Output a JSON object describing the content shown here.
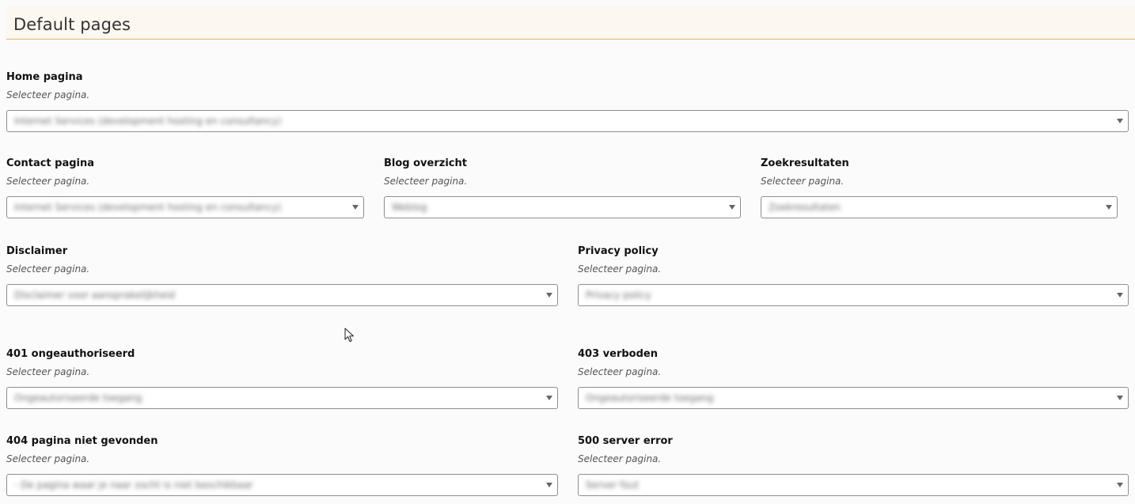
{
  "section": {
    "title": "Default pages"
  },
  "fields": {
    "home": {
      "label": "Home pagina",
      "hint": "Selecteer pagina.",
      "value": "Internet Services (development hosting en consultancy)"
    },
    "contact": {
      "label": "Contact pagina",
      "hint": "Selecteer pagina.",
      "value": "Internet Services (development hosting en consultancy)"
    },
    "blog": {
      "label": "Blog overzicht",
      "hint": "Selecteer pagina.",
      "value": "Weblog"
    },
    "search": {
      "label": "Zoekresultaten",
      "hint": "Selecteer pagina.",
      "value": "Zoekresultaten"
    },
    "disclaimer": {
      "label": "Disclaimer",
      "hint": "Selecteer pagina.",
      "value": "Disclaimer voor aansprakelijkheid"
    },
    "privacy": {
      "label": "Privacy policy",
      "hint": "Selecteer pagina.",
      "value": "Privacy policy"
    },
    "e401": {
      "label": "401 ongeauthoriseerd",
      "hint": "Selecteer pagina.",
      "value": "Ongeautoriseerde toegang"
    },
    "e403": {
      "label": "403 verboden",
      "hint": "Selecteer pagina.",
      "value": "Ongeautoriseerde toegang"
    },
    "e404": {
      "label": "404 pagina niet gevonden",
      "hint": "Selecteer pagina.",
      "value": "- De pagina waar je naar zocht is niet beschikbaar"
    },
    "e500": {
      "label": "500 server error",
      "hint": "Selecteer pagina.",
      "value": "Server fout"
    }
  },
  "icons": {
    "dropdown": "chevron-down-icon",
    "cursor": "mouse-pointer-icon"
  },
  "colors": {
    "header_bg": "#fdf8ef",
    "header_border": "#e4b45c",
    "page_bg": "#fbfbfb",
    "select_border": "#8e8e8e"
  }
}
